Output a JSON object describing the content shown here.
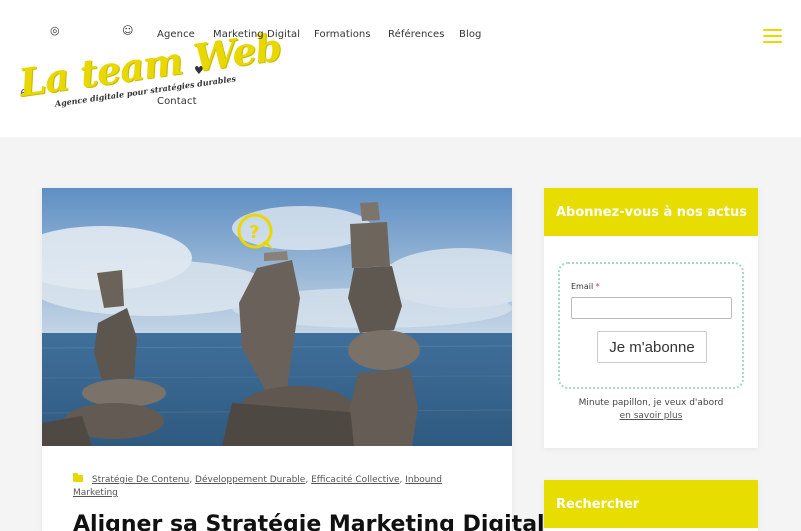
{
  "header": {
    "logo": {
      "name": "La team Web",
      "tagline": "Agence digitale pour stratégies durables"
    },
    "nav": [
      {
        "label": "Agence"
      },
      {
        "label": "Marketing Digital"
      },
      {
        "label": "Formations"
      },
      {
        "label": "Références"
      },
      {
        "label": "Blog"
      },
      {
        "label": "Contact"
      }
    ],
    "menu_icon": "hamburger-icon"
  },
  "post": {
    "image_description_icon": "balanced-stones-photo",
    "categories": [
      "Stratégie De Contenu",
      "Développement Durable",
      "Efficacité Collective",
      "Inbound Marketing"
    ],
    "title": "Aligner sa Stratégie Marketing Digital"
  },
  "sidebar": {
    "newsletter": {
      "title": "Abonnez-vous à nos actus",
      "email_label": "Email",
      "required_mark": "*",
      "email_value": "",
      "subscribe_label": "Je m'abonne",
      "note": "Minute papillon, je veux d'abord",
      "more_link": "en savoir plus"
    },
    "search": {
      "title": "Rechercher"
    }
  },
  "colors": {
    "accent": "#e8dd00",
    "form_border": "#a8d9c6",
    "background": "#f4f4f4"
  }
}
